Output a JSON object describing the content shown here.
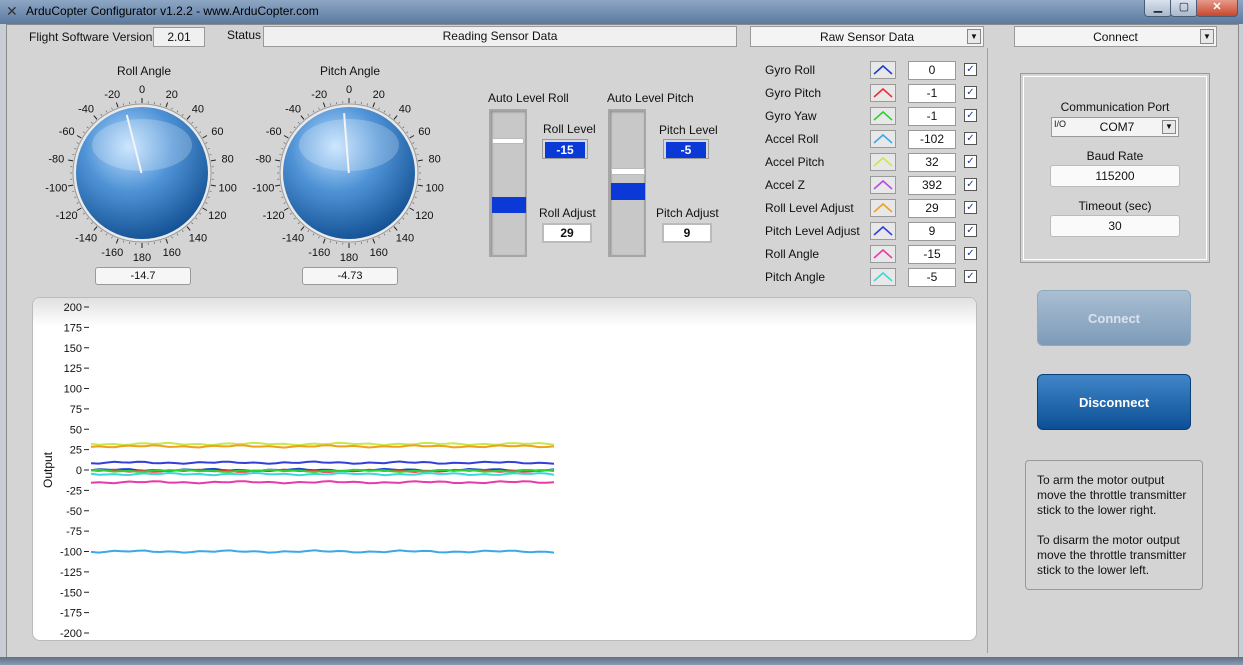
{
  "window": {
    "title": "ArduCopter Configurator v1.2.2 - www.ArduCopter.com"
  },
  "header": {
    "fw_label": "Flight Software Version",
    "fw_value": "2.01",
    "status_label": "Status",
    "status_value": "Reading Sensor Data",
    "mode_select": "Raw Sensor Data",
    "connect_select": "Connect"
  },
  "dials": [
    {
      "title": "Roll Angle",
      "value": "-14.7",
      "needle_deg": -14.7
    },
    {
      "title": "Pitch Angle",
      "value": "-4.73",
      "needle_deg": -4.73
    }
  ],
  "dial_scale": [
    "0",
    "20",
    "40",
    "60",
    "80",
    "100",
    "120",
    "140",
    "160",
    "180",
    "-160",
    "-140",
    "-120",
    "-100",
    "-80",
    "-60",
    "-40",
    "-20"
  ],
  "auto_level": {
    "roll": {
      "title": "Auto Level Roll",
      "level_label": "Roll Level",
      "level_value": "-15",
      "adjust_label": "Roll Adjust",
      "adjust_value": "29"
    },
    "pitch": {
      "title": "Auto Level Pitch",
      "level_label": "Pitch Level",
      "level_value": "-5",
      "adjust_label": "Pitch Adjust",
      "adjust_value": "9"
    }
  },
  "sensors": [
    {
      "name": "Gyro Roll",
      "value": "0",
      "color": "#1f3fd0"
    },
    {
      "name": "Gyro Pitch",
      "value": "-1",
      "color": "#e8303a"
    },
    {
      "name": "Gyro Yaw",
      "value": "-1",
      "color": "#2ed12e"
    },
    {
      "name": "Accel Roll",
      "value": "-102",
      "color": "#3aa9e8"
    },
    {
      "name": "Accel Pitch",
      "value": "32",
      "color": "#c9e84a"
    },
    {
      "name": "Accel Z",
      "value": "392",
      "color": "#b84ae8"
    },
    {
      "name": "Roll Level Adjust",
      "value": "29",
      "color": "#f0a020"
    },
    {
      "name": "Pitch Level Adjust",
      "value": "9",
      "color": "#3340d8"
    },
    {
      "name": "Roll Angle",
      "value": "-15",
      "color": "#e83aa8"
    },
    {
      "name": "Pitch Angle",
      "value": "-5",
      "color": "#3ad8d8"
    }
  ],
  "chart_data": {
    "type": "line",
    "title": "",
    "ylabel": "Output",
    "xlabel": "",
    "ylim": [
      -200,
      200
    ],
    "yticks": [
      "200",
      "175",
      "150",
      "125",
      "100",
      "75",
      "50",
      "25",
      "0",
      "-25",
      "-50",
      "-75",
      "-100",
      "-125",
      "-150",
      "-175",
      "-200"
    ],
    "series": [
      {
        "name": "Accel Pitch",
        "color": "#c9e84a",
        "value": 32
      },
      {
        "name": "Roll Level Adjust",
        "color": "#f0a020",
        "value": 29
      },
      {
        "name": "Pitch Level Adjust",
        "color": "#3340d8",
        "value": 9
      },
      {
        "name": "Gyro Roll",
        "color": "#1f3fd0",
        "value": 0
      },
      {
        "name": "Gyro Pitch",
        "color": "#e8303a",
        "value": -1
      },
      {
        "name": "Gyro Yaw",
        "color": "#2ed12e",
        "value": -1
      },
      {
        "name": "Pitch Angle",
        "color": "#3ad8d8",
        "value": -5
      },
      {
        "name": "Roll Angle",
        "color": "#e83aa8",
        "value": -15
      },
      {
        "name": "Accel Roll",
        "color": "#3aa9e8",
        "value": -100
      }
    ]
  },
  "comm": {
    "port_label": "Communication Port",
    "port_value": "COM7",
    "baud_label": "Baud Rate",
    "baud_value": "115200",
    "timeout_label": "Timeout (sec)",
    "timeout_value": "30"
  },
  "buttons": {
    "connect": "Connect",
    "disconnect": "Disconnect"
  },
  "info": {
    "arm": "To arm the motor output move the throttle transmitter stick to the lower right.",
    "disarm": "To disarm the motor output move the throttle transmitter stick to the lower left."
  }
}
